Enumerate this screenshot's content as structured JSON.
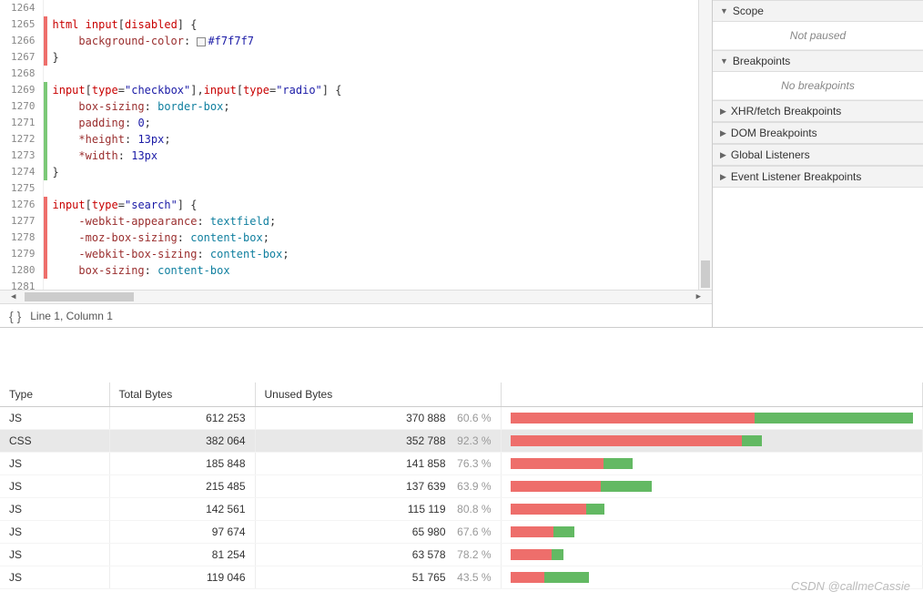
{
  "code": {
    "lines": [
      {
        "num": 1264,
        "mark": "",
        "html": ""
      },
      {
        "num": 1265,
        "mark": "red",
        "html": "<span class='tok-sel'>html</span> <span class='tok-sel'>input</span>[<span class='tok-sel'>disabled</span>] {"
      },
      {
        "num": 1266,
        "mark": "red",
        "html": "    <span class='tok-prop'>background-color</span>: <span class='swatch'></span><span class='tok-num'>#f7f7f7</span>"
      },
      {
        "num": 1267,
        "mark": "red",
        "html": "}"
      },
      {
        "num": 1268,
        "mark": "",
        "html": ""
      },
      {
        "num": 1269,
        "mark": "green",
        "html": "<span class='tok-sel'>input</span>[<span class='tok-sel'>type</span>=<span class='tok-str'>\"checkbox\"</span>],<span class='tok-sel'>input</span>[<span class='tok-sel'>type</span>=<span class='tok-str'>\"radio\"</span>] {"
      },
      {
        "num": 1270,
        "mark": "green",
        "html": "    <span class='tok-prop'>box-sizing</span>: <span class='tok-val'>border-box</span>;"
      },
      {
        "num": 1271,
        "mark": "green",
        "html": "    <span class='tok-prop'>padding</span>: <span class='tok-num'>0</span>;"
      },
      {
        "num": 1272,
        "mark": "green",
        "html": "    <span class='tok-prop'>*height</span>: <span class='tok-num'>13px</span>;"
      },
      {
        "num": 1273,
        "mark": "green",
        "html": "    <span class='tok-prop'>*width</span>: <span class='tok-num'>13px</span>"
      },
      {
        "num": 1274,
        "mark": "green",
        "html": "}"
      },
      {
        "num": 1275,
        "mark": "",
        "html": ""
      },
      {
        "num": 1276,
        "mark": "red",
        "html": "<span class='tok-sel'>input</span>[<span class='tok-sel'>type</span>=<span class='tok-str'>\"search\"</span>] {"
      },
      {
        "num": 1277,
        "mark": "red",
        "html": "    <span class='tok-prop'>-webkit-appearance</span>: <span class='tok-val'>textfield</span>;"
      },
      {
        "num": 1278,
        "mark": "red",
        "html": "    <span class='tok-prop'>-moz-box-sizing</span>: <span class='tok-val'>content-box</span>;"
      },
      {
        "num": 1279,
        "mark": "red",
        "html": "    <span class='tok-prop'>-webkit-box-sizing</span>: <span class='tok-val'>content-box</span>;"
      },
      {
        "num": 1280,
        "mark": "red",
        "html": "    <span class='tok-prop'>box-sizing</span>: <span class='tok-val'>content-box</span>"
      },
      {
        "num": 1281,
        "mark": "",
        "html": ""
      }
    ],
    "status": "Line 1, Column 1"
  },
  "sidebar": {
    "sections": [
      {
        "label": "Scope",
        "expanded": true,
        "body": "Not paused"
      },
      {
        "label": "Breakpoints",
        "expanded": true,
        "body": "No breakpoints"
      },
      {
        "label": "XHR/fetch Breakpoints",
        "expanded": false
      },
      {
        "label": "DOM Breakpoints",
        "expanded": false
      },
      {
        "label": "Global Listeners",
        "expanded": false
      },
      {
        "label": "Event Listener Breakpoints",
        "expanded": false
      }
    ]
  },
  "coverage": {
    "headers": [
      "Type",
      "Total Bytes",
      "Unused Bytes",
      ""
    ],
    "maxTotal": 612253,
    "rows": [
      {
        "type": "JS",
        "total": "612 253",
        "unused": "370 888",
        "pct": "60.6 %",
        "totalN": 612253,
        "unusedN": 370888,
        "sel": false
      },
      {
        "type": "CSS",
        "total": "382 064",
        "unused": "352 788",
        "pct": "92.3 %",
        "totalN": 382064,
        "unusedN": 352788,
        "sel": true
      },
      {
        "type": "JS",
        "total": "185 848",
        "unused": "141 858",
        "pct": "76.3 %",
        "totalN": 185848,
        "unusedN": 141858,
        "sel": false
      },
      {
        "type": "JS",
        "total": "215 485",
        "unused": "137 639",
        "pct": "63.9 %",
        "totalN": 215485,
        "unusedN": 137639,
        "sel": false
      },
      {
        "type": "JS",
        "total": "142 561",
        "unused": "115 119",
        "pct": "80.8 %",
        "totalN": 142561,
        "unusedN": 115119,
        "sel": false
      },
      {
        "type": "JS",
        "total": "97 674",
        "unused": "65 980",
        "pct": "67.6 %",
        "totalN": 97674,
        "unusedN": 65980,
        "sel": false
      },
      {
        "type": "JS",
        "total": "81 254",
        "unused": "63 578",
        "pct": "78.2 %",
        "totalN": 81254,
        "unusedN": 63578,
        "sel": false
      },
      {
        "type": "JS",
        "total": "119 046",
        "unused": "51 765",
        "pct": "43.5 %",
        "totalN": 119046,
        "unusedN": 51765,
        "sel": false
      }
    ]
  },
  "watermark": "CSDN @callmeCassie"
}
